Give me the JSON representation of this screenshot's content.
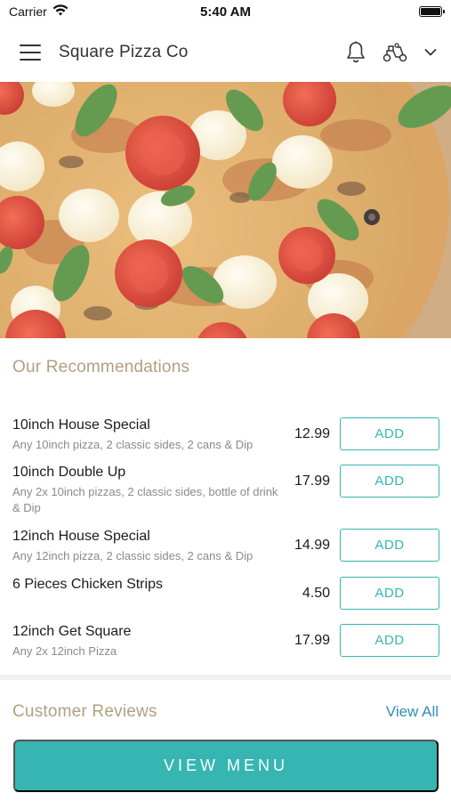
{
  "status_bar": {
    "carrier": "Carrier",
    "time": "5:40 AM",
    "icons": [
      "wifi-icon",
      "battery-icon"
    ]
  },
  "header": {
    "title": "Square Pizza Co",
    "icons": [
      "hamburger-menu-icon",
      "bell-icon",
      "scooter-delivery-icon",
      "chevron-down-icon"
    ]
  },
  "hero": {
    "image": "pizza with tomatoes, mozzarella and basil"
  },
  "recommendations": {
    "title": "Our Recommendations",
    "add_label": "ADD",
    "items": [
      {
        "name": "10inch House Special",
        "description": "Any 10inch pizza, 2 classic sides, 2 cans & Dip",
        "price": "12.99"
      },
      {
        "name": "10inch Double Up",
        "description": "Any 2x 10inch pizzas, 2 classic sides, bottle of drink & Dip",
        "price": "17.99"
      },
      {
        "name": "12inch House Special",
        "description": "Any 12inch pizza, 2 classic sides, 2 cans & Dip",
        "price": "14.99"
      },
      {
        "name": "6 Pieces Chicken Strips",
        "description": "",
        "price": "4.50"
      },
      {
        "name": "12inch Get Square",
        "description": "Any 2x 12inch Pizza",
        "price": "17.99"
      }
    ]
  },
  "reviews": {
    "title": "Customer Reviews",
    "view_all": "View All"
  },
  "footer": {
    "view_menu": "VIEW MENU"
  },
  "colors": {
    "accent": "#36b5b3",
    "section_title": "#b39f7f",
    "link": "#2f8fb5"
  }
}
